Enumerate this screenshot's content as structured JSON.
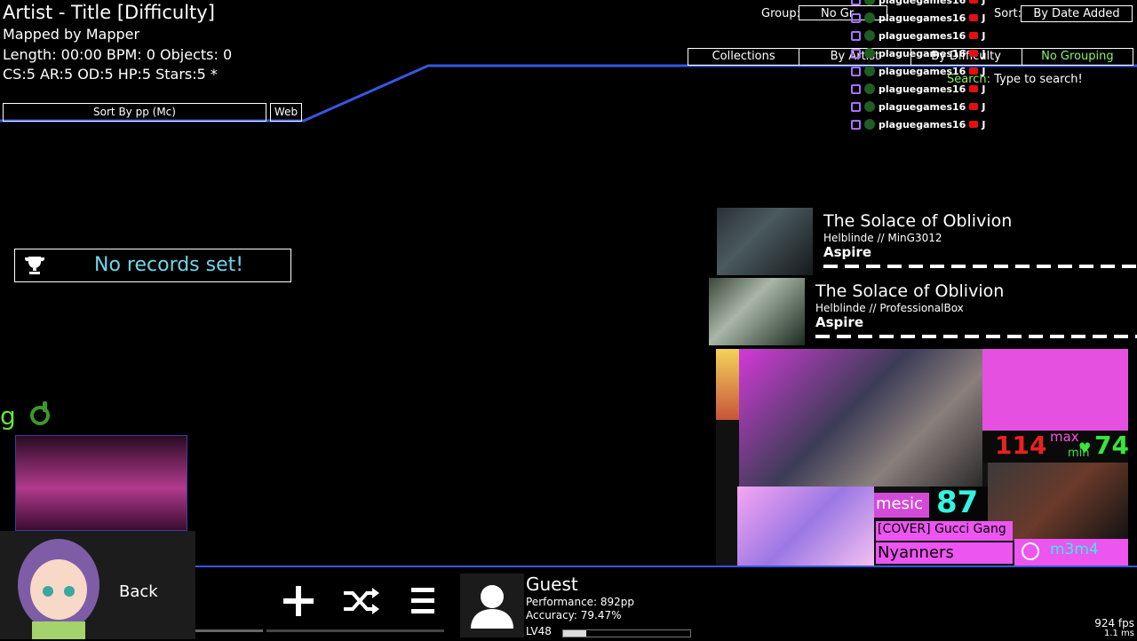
{
  "beatmap": {
    "title": "Artist - Title [Difficulty]",
    "mapped_by": "Mapped by Mapper",
    "stats1": "Length: 00:00 BPM: 0 Objects: 0",
    "stats2": "CS:5 AR:5 OD:5 HP:5 Stars:5 *"
  },
  "sort_button": "Sort By pp (Mc)",
  "web_button": "Web",
  "records_text": "No records set!",
  "group": {
    "label": "Group:",
    "value": "No Gr"
  },
  "sort": {
    "label": "Sort:",
    "value": "By Date Added"
  },
  "tabs": [
    "Collections",
    "By Artist",
    "By Difficulty",
    "No Grouping"
  ],
  "search": {
    "label": "Search:",
    "placeholder": "Type to search!"
  },
  "chat_user": "plaguegames16",
  "chat_rows": 8,
  "songs": [
    {
      "title": "The Solace of Oblivion",
      "sub": "Helblinde // MinG3012",
      "diff": "Aspire"
    },
    {
      "title": "The Solace of Oblivion",
      "sub": "Helblinde // ProfessionalBox",
      "diff": "Aspire"
    }
  ],
  "overlay": {
    "bpm_max": "114",
    "max_label": "max",
    "bpm_min": "74",
    "min_label": "min",
    "counter": "87",
    "song": "[COVER] Gucci Gang",
    "artist": "Nyanners",
    "tag": "m3m4",
    "partial": "mesic"
  },
  "left_partial": "g",
  "back_label": "Back",
  "user": {
    "name": "Guest",
    "performance": "Performance: 892pp",
    "accuracy": "Accuracy: 79.47%",
    "level": "LV48",
    "level_progress": 0.18
  },
  "fps": "924 fps",
  "ms": "1.1 ms",
  "colors": {
    "accent": "#3657e0",
    "green": "#8ff062",
    "cyan": "#6fd6e8"
  }
}
